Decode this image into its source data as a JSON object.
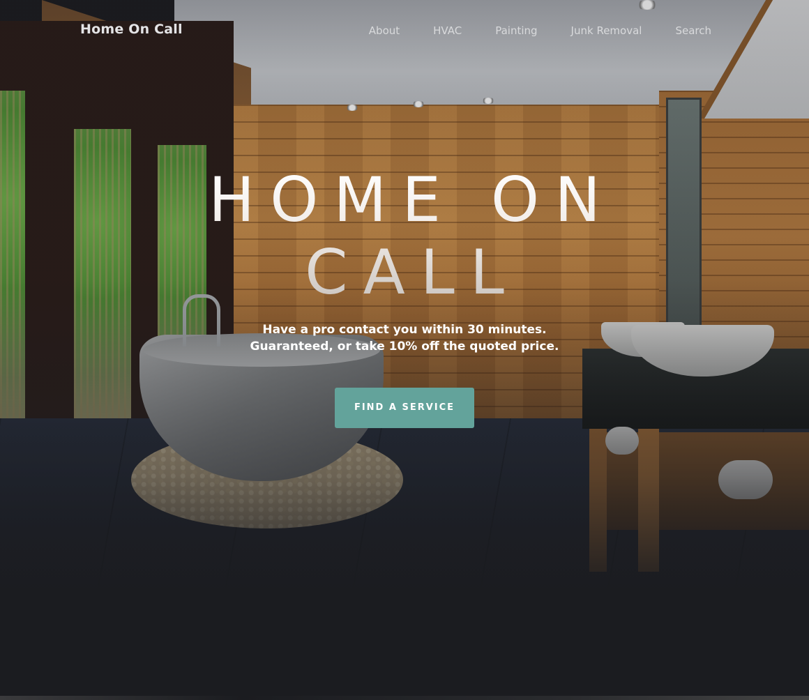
{
  "brand": {
    "name": "Home On Call"
  },
  "nav": {
    "items": [
      {
        "label": "About"
      },
      {
        "label": "HVAC"
      },
      {
        "label": "Painting"
      },
      {
        "label": "Junk Removal"
      },
      {
        "label": "Search"
      }
    ]
  },
  "hero": {
    "title": "HOME ON CALL",
    "subtitle_line1": "Have a pro contact you within 30 minutes.",
    "subtitle_line2": "Guaranteed, or take 10% off the quoted price.",
    "cta_label": "FIND A SERVICE"
  },
  "colors": {
    "accent": "#63a39b",
    "background": "#1b1c20",
    "text": "#ffffff"
  }
}
